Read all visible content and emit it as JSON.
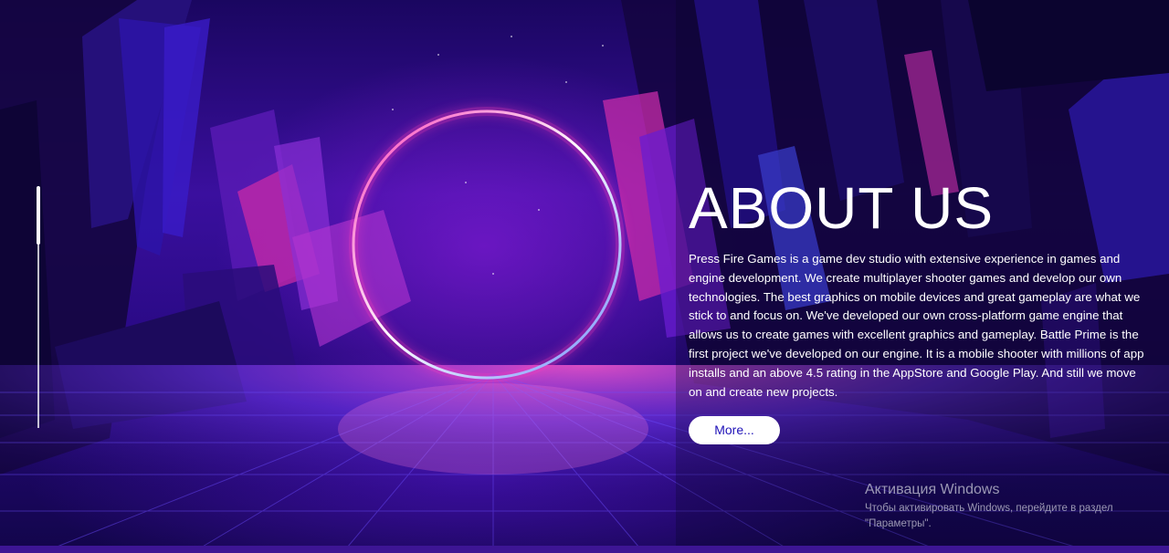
{
  "about": {
    "title": "ABOUT US",
    "description": "Press Fire Games is a game dev studio with extensive experience in games and engine development. We create multiplayer shooter games and develop our own technologies. The best graphics on mobile devices and great gameplay are what we stick to and focus on. We've developed our own cross-platform game engine that allows us to create games with excellent graphics and gameplay. Battle Prime is the first project we've developed on our engine. It is a mobile shooter with millions of app installs and an above 4.5 rating in the AppStore and Google Play. And still we move on and create new projects.",
    "more_label": "More..."
  },
  "windows_activation": {
    "title": "Активация Windows",
    "text": "Чтобы активировать Windows, перейдите в раздел \"Параметры\"."
  },
  "colors": {
    "accent_button_text": "#1f12b8",
    "ring_pink": "#ff3db8",
    "ring_blue": "#6d8bff",
    "background_purple": "#3a0f9e"
  }
}
